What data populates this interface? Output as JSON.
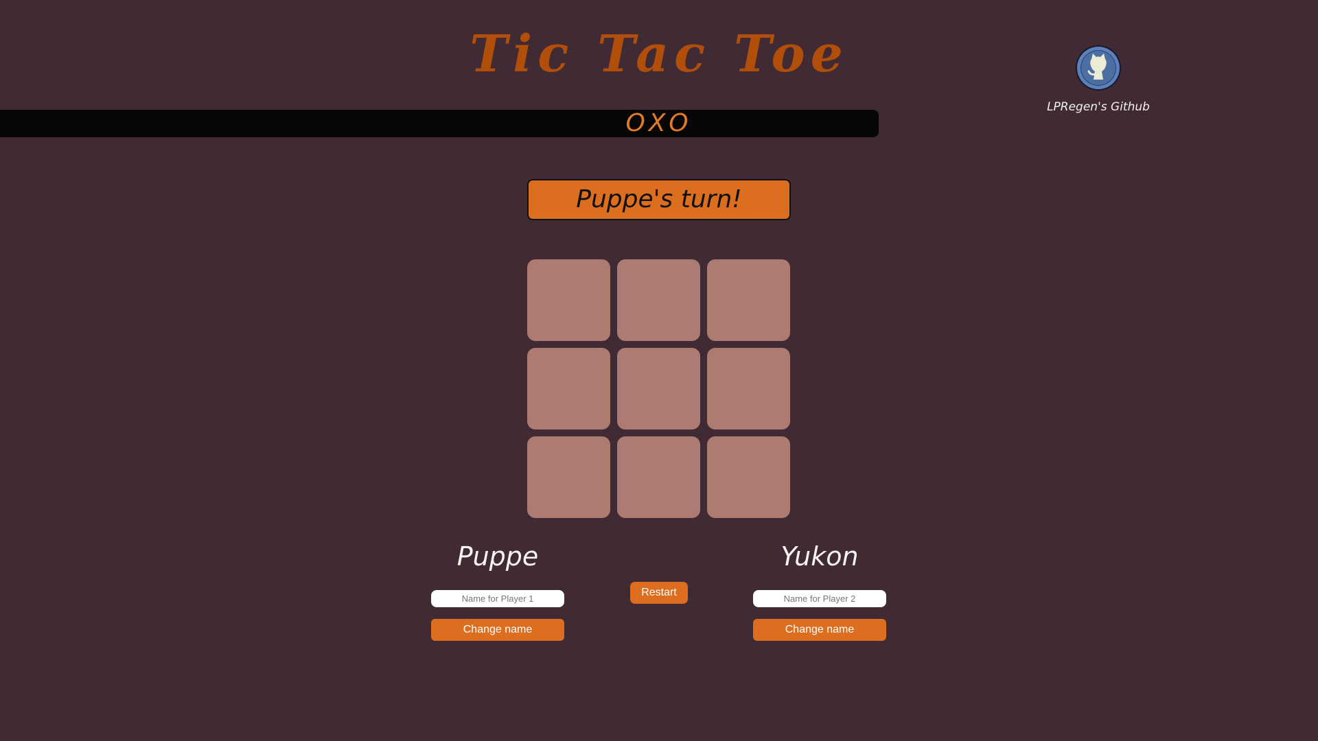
{
  "header": {
    "title": "Tic Tac Toe",
    "banner_text": "OXO"
  },
  "status": {
    "turn_text": "Puppe's turn!"
  },
  "board": {
    "cells": [
      "",
      "",
      "",
      "",
      "",
      "",
      "",
      "",
      ""
    ]
  },
  "github": {
    "label": "LPRegen's Github",
    "icon": "github-octocat-icon"
  },
  "players": [
    {
      "name": "Puppe",
      "input_placeholder": "Name for Player 1",
      "input_value": "",
      "change_label": "Change name"
    },
    {
      "name": "Yukon",
      "input_placeholder": "Name for Player 2",
      "input_value": "",
      "change_label": "Change name"
    }
  ],
  "controls": {
    "restart_label": "Restart"
  },
  "colors": {
    "background": "#402a34",
    "accent": "#dc6e20",
    "title": "#b04e0a",
    "cell": "#ad7b72",
    "banner": "#060606",
    "github_circle": "#4d6ea3"
  }
}
